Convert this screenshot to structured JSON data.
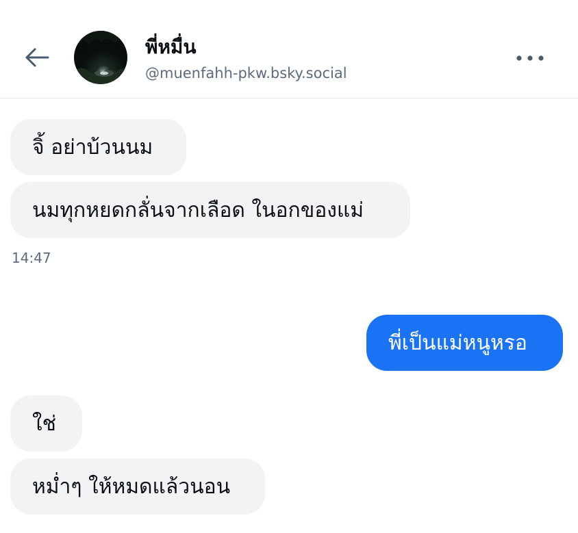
{
  "header": {
    "back_icon": "arrow-left-icon",
    "display_name": "พี่หมื่น",
    "handle": "@muenfahh-pkw.bsky.social",
    "more_icon": "ellipsis-icon"
  },
  "messages": [
    {
      "direction": "incoming",
      "text": "จิ้ อย่าบ้วนนม"
    },
    {
      "direction": "incoming",
      "text": "นมทุกหยดกลั่นจากเลือด ในอกของแม่"
    },
    {
      "direction": "outgoing",
      "text": "พี่เป็นแม่หนูหรอ"
    },
    {
      "direction": "incoming",
      "text": "ใช่"
    },
    {
      "direction": "incoming",
      "text": "หม่ำๆ ให้หมดแล้วนอน"
    }
  ],
  "timestamps": [
    "14:47"
  ],
  "colors": {
    "outgoing_bubble": "#1a73f5",
    "incoming_bubble": "#f1f3f5",
    "secondary_text": "#5b6b7e"
  }
}
